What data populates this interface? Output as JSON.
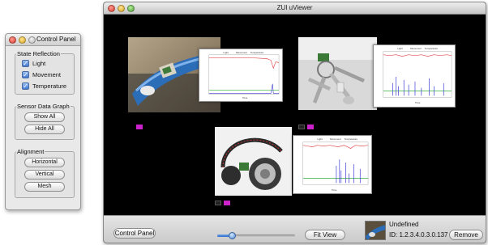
{
  "control_panel": {
    "title": "Control Panel",
    "state_reflection": {
      "legend": "State Reflection",
      "items": [
        {
          "label": "Light",
          "checked": true
        },
        {
          "label": "Movement",
          "checked": true
        },
        {
          "label": "Temperature",
          "checked": true
        }
      ]
    },
    "sensor_graph": {
      "legend": "Sensor Data Graph",
      "show_all": "Show All",
      "hide_all": "Hide All"
    },
    "alignment": {
      "legend": "Alignment",
      "horizontal": "Horizontal",
      "vertical": "Vertical",
      "mesh": "Mesh"
    }
  },
  "viewer": {
    "title": "ZUI uViewer",
    "graph_legend": [
      "Light",
      "Movement",
      "Temperature"
    ],
    "graph_xlabel": "Time",
    "bottom": {
      "control_panel_button": "Control Panel",
      "fit_view_button": "Fit View",
      "remove_button": "Remove",
      "zoom_level": 0.2,
      "selected_name": "Undefined",
      "selected_id": "ID: 1.2.3.4.0.3.0.137"
    },
    "colors": {
      "light_series": "#e05050",
      "movement_series": "#3b3bd6",
      "temperature_series": "#2fae3a",
      "swatch_magenta": "#cc22cc",
      "swatch_dark": "#222222"
    },
    "tiles": [
      {
        "object": "blue device on desk",
        "swatches": [
          "magenta"
        ]
      },
      {
        "object": "keys with sensor",
        "swatches": [
          "dark",
          "magenta"
        ]
      },
      {
        "object": "headphones with sensor",
        "swatches": [
          "dark",
          "magenta"
        ]
      }
    ]
  }
}
